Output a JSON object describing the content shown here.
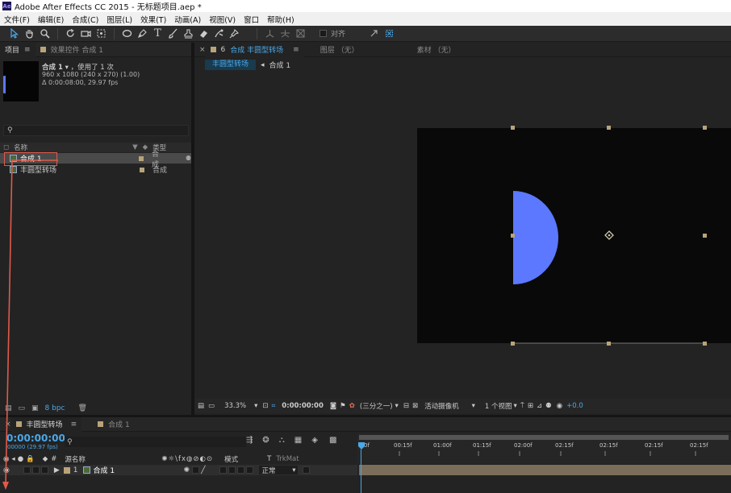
{
  "window": {
    "title": "Adobe After Effects CC 2015 - 无标题项目.aep *",
    "icon_text": "Ae"
  },
  "menu": [
    "文件(F)",
    "编辑(E)",
    "合成(C)",
    "图层(L)",
    "效果(T)",
    "动画(A)",
    "视图(V)",
    "窗口",
    "帮助(H)"
  ],
  "toolbar": {
    "align_label": "对齐"
  },
  "project_panel": {
    "tabs": [
      {
        "label": "项目",
        "active": true
      },
      {
        "label": "效果控件 合成 1",
        "active": false
      }
    ],
    "preview": {
      "name": "合成 1",
      "usage": "，使用了 1 次",
      "resolution": "960 x 1080  (240 x 270) (1.00)",
      "duration": "Δ 0:00:08:00, 29.97 fps"
    },
    "search_placeholder": "",
    "columns": {
      "name": "名称",
      "type": "类型"
    },
    "items": [
      {
        "name": "合成 1",
        "type": "合成",
        "selected": true
      },
      {
        "name": "丰圆型转场",
        "type": "合成",
        "selected": false
      }
    ],
    "bpc": "8 bpc"
  },
  "comp_panel": {
    "tabs": [
      {
        "label": "合成 丰圆型转场",
        "active": true
      },
      {
        "label": "图层 （无）",
        "active": false
      },
      {
        "label": "素材 （无）",
        "active": false
      }
    ],
    "breadcrumbs": [
      "丰圆型转场",
      "合成 1"
    ],
    "footer": {
      "zoom": "33.3%",
      "timecode": "0:00:00:00",
      "resolution": "(三分之一)",
      "camera": "活动摄像机",
      "views": "1 个视图",
      "exposure": "+0.0"
    },
    "shape_color": "#5b78ff"
  },
  "timeline": {
    "tabs": [
      {
        "label": "丰圆型转场",
        "active": true
      },
      {
        "label": "合成 1",
        "active": false
      }
    ],
    "timecode": "0:00:00:00",
    "fps_info": "00000 (29.97 fps)",
    "columns": {
      "source": "源名称",
      "mode": "模式",
      "t": "T",
      "trkmat": "TrkMat"
    },
    "ruler": [
      "0f",
      "00:15f",
      "01:00f",
      "01:15f",
      "02:00f",
      "02:15f",
      "02:15f",
      "02:15f",
      "02:15f"
    ],
    "layers": [
      {
        "index": "1",
        "name": "合成 1",
        "mode": "正常"
      }
    ]
  },
  "colors": {
    "accent": "#4aa8e8",
    "annotation": "#e05a4a"
  }
}
